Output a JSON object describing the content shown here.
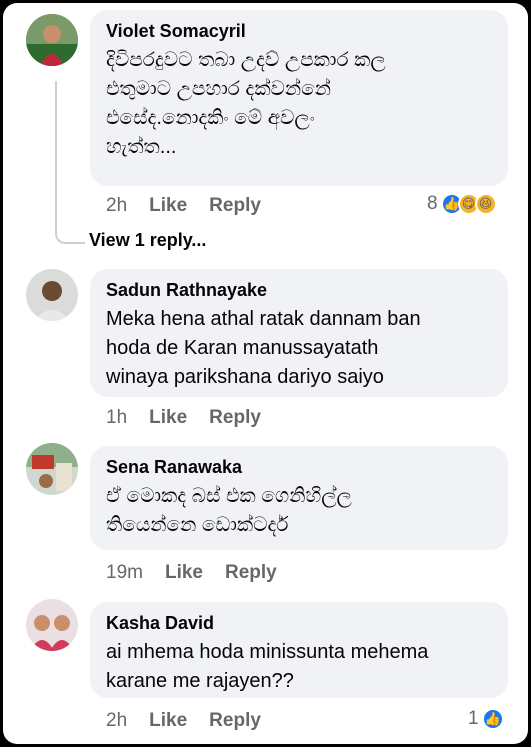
{
  "comments": [
    {
      "author": "Violet Somacyril",
      "text": "දිවිපරදුවට තබා උදව් උපකාර කල\nඑතුමාට උපහාර දක්වන්නේ\nඑසේද.නොදකිං  මේ අවලං\nහැත්ත...",
      "time": "2h",
      "like": "Like",
      "reply": "Reply",
      "reaction_count": "8",
      "reactions": [
        "like-icon",
        "haha-icon",
        "laugh-icon"
      ]
    },
    {
      "author": "Sadun Rathnayake",
      "text": "Meka hena athal ratak dannam ban\nhoda de Karan manussayatath\nwinaya parikshana dariyo saiyo",
      "time": "1h",
      "like": "Like",
      "reply": "Reply"
    },
    {
      "author": "Sena Ranawaka",
      "text": "ඒ මොකද බස් එක ගෙනිහිල්ල\nතියෙන්නෙ ඩොක්ටර්ද",
      "time": "19m",
      "like": "Like",
      "reply": "Reply"
    },
    {
      "author": "Kasha David",
      "text": "ai mhema hoda minissunta mehema\nkarane me rajayen??",
      "time": "2h",
      "like": "Like",
      "reply": "Reply",
      "reaction_count": "1",
      "reactions": [
        "like-icon"
      ]
    }
  ],
  "view_replies": "View 1 reply...",
  "colors": {
    "bubble": "#f0f2f5",
    "meta": "#65676b",
    "like_blue": "#1877f2"
  }
}
